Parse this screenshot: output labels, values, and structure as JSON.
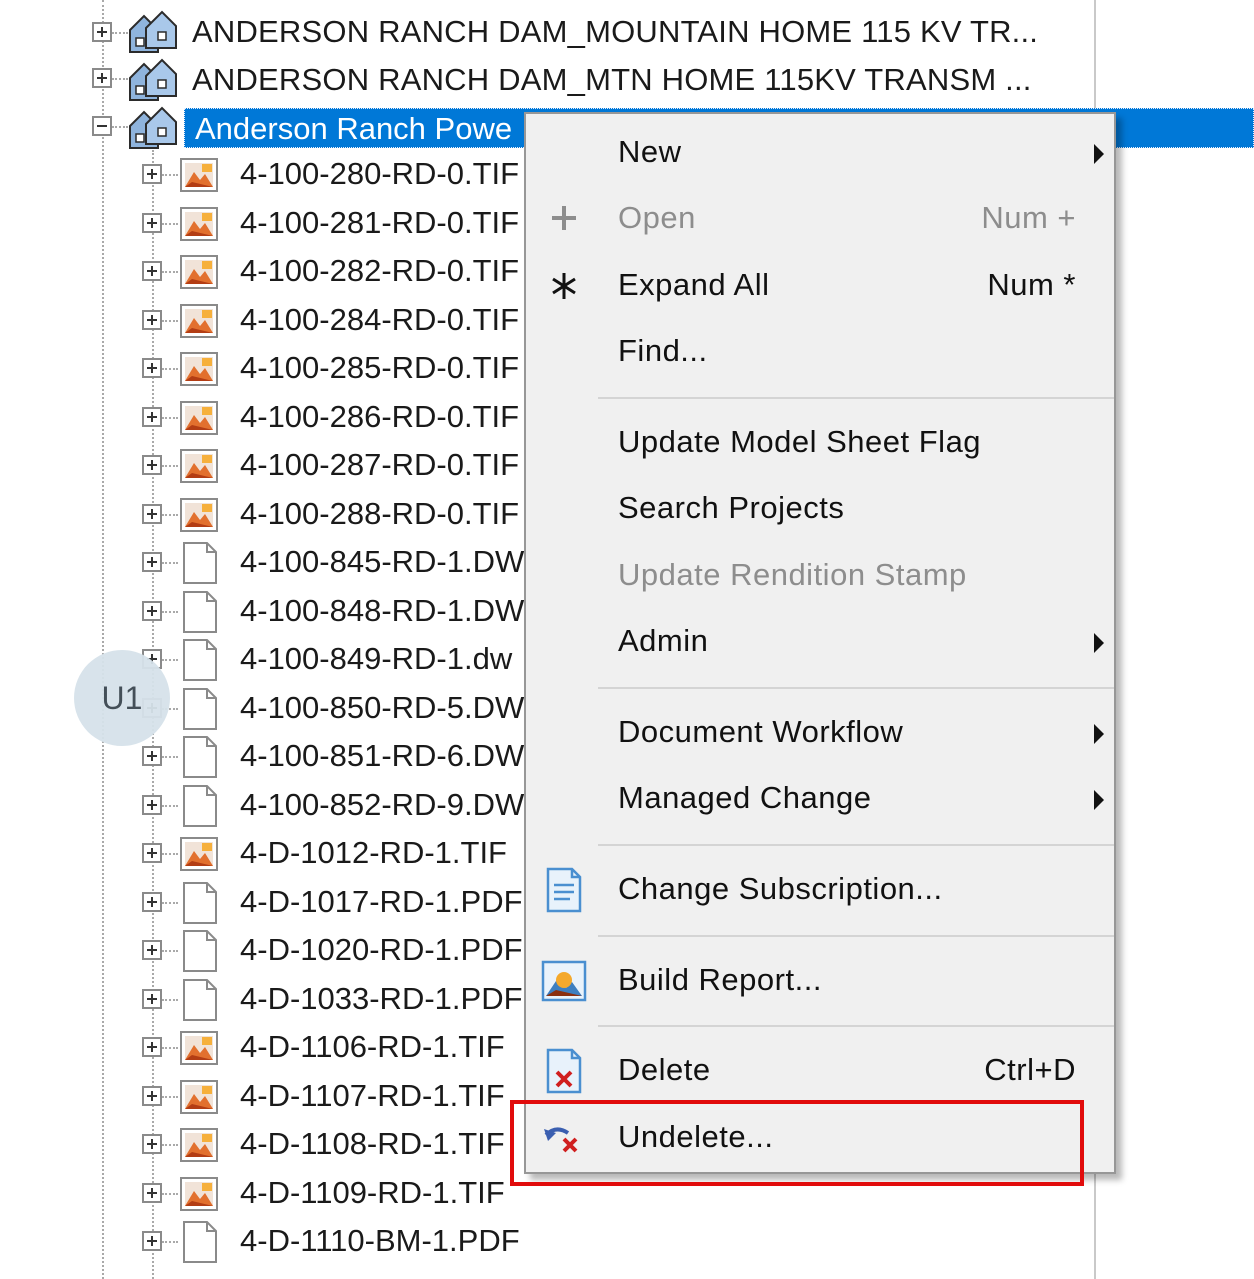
{
  "tree": {
    "top_rows": [
      {
        "label": "ANDERSON RANCH DAM_MOUNTAIN HOME 115 KV TR...",
        "expanded": false
      },
      {
        "label": "ANDERSON RANCH DAM_MTN HOME 115KV TRANSM ...",
        "expanded": false
      }
    ],
    "selected_row": {
      "label": "Anderson Ranch Powe",
      "expanded": true
    },
    "children": [
      {
        "label": "4-100-280-RD-0.TIF",
        "icon": "image-file-icon"
      },
      {
        "label": "4-100-281-RD-0.TIF",
        "icon": "image-file-icon"
      },
      {
        "label": "4-100-282-RD-0.TIF",
        "icon": "image-file-icon"
      },
      {
        "label": "4-100-284-RD-0.TIF",
        "icon": "image-file-icon"
      },
      {
        "label": "4-100-285-RD-0.TIF",
        "icon": "image-file-icon"
      },
      {
        "label": "4-100-286-RD-0.TIF",
        "icon": "image-file-icon"
      },
      {
        "label": "4-100-287-RD-0.TIF",
        "icon": "image-file-icon"
      },
      {
        "label": "4-100-288-RD-0.TIF",
        "icon": "image-file-icon"
      },
      {
        "label": "4-100-845-RD-1.DW",
        "icon": "document-file-icon"
      },
      {
        "label": "4-100-848-RD-1.DW",
        "icon": "document-file-icon"
      },
      {
        "label": "4-100-849-RD-1.dw",
        "icon": "document-file-icon"
      },
      {
        "label": "4-100-850-RD-5.DW",
        "icon": "document-file-icon"
      },
      {
        "label": "4-100-851-RD-6.DW",
        "icon": "document-file-icon"
      },
      {
        "label": "4-100-852-RD-9.DW",
        "icon": "document-file-icon"
      },
      {
        "label": "4-D-1012-RD-1.TIF",
        "icon": "image-file-icon"
      },
      {
        "label": "4-D-1017-RD-1.PDF",
        "icon": "document-file-icon"
      },
      {
        "label": "4-D-1020-RD-1.PDF",
        "icon": "document-file-icon"
      },
      {
        "label": "4-D-1033-RD-1.PDF",
        "icon": "document-file-icon"
      },
      {
        "label": "4-D-1106-RD-1.TIF",
        "icon": "image-file-icon"
      },
      {
        "label": "4-D-1107-RD-1.TIF",
        "icon": "image-file-icon"
      },
      {
        "label": "4-D-1108-RD-1.TIF",
        "icon": "image-file-icon"
      },
      {
        "label": "4-D-1109-RD-1.TIF",
        "icon": "image-file-icon"
      },
      {
        "label": "4-D-1110-BM-1.PDF",
        "icon": "document-file-icon"
      }
    ]
  },
  "badge": {
    "label": "U1"
  },
  "context_menu": {
    "items": [
      {
        "id": "new",
        "label": "New",
        "shortcut": "",
        "submenu": true,
        "disabled": false,
        "icon": ""
      },
      {
        "id": "open",
        "label": "Open",
        "shortcut": "Num +",
        "submenu": false,
        "disabled": true,
        "icon": "plus-icon"
      },
      {
        "id": "expand-all",
        "label": "Expand All",
        "shortcut": "Num *",
        "submenu": false,
        "disabled": false,
        "icon": "asterisk-icon"
      },
      {
        "id": "find",
        "label": "Find...",
        "shortcut": "",
        "submenu": false,
        "disabled": false,
        "icon": ""
      },
      {
        "id": "update-model-sheet-flag",
        "label": "Update Model Sheet Flag",
        "shortcut": "",
        "submenu": false,
        "disabled": false,
        "icon": ""
      },
      {
        "id": "search-projects",
        "label": "Search Projects",
        "shortcut": "",
        "submenu": false,
        "disabled": false,
        "icon": ""
      },
      {
        "id": "update-rendition-stamp",
        "label": "Update Rendition Stamp",
        "shortcut": "",
        "submenu": false,
        "disabled": true,
        "icon": ""
      },
      {
        "id": "admin",
        "label": "Admin",
        "shortcut": "",
        "submenu": true,
        "disabled": false,
        "icon": ""
      },
      {
        "id": "document-workflow",
        "label": "Document Workflow",
        "shortcut": "",
        "submenu": true,
        "disabled": false,
        "icon": ""
      },
      {
        "id": "managed-change",
        "label": "Managed Change",
        "shortcut": "",
        "submenu": true,
        "disabled": false,
        "icon": ""
      },
      {
        "id": "change-subscription",
        "label": "Change Subscription...",
        "shortcut": "",
        "submenu": false,
        "disabled": false,
        "icon": "subscription-document-icon"
      },
      {
        "id": "build-report",
        "label": "Build Report...",
        "shortcut": "",
        "submenu": false,
        "disabled": false,
        "icon": "report-image-icon"
      },
      {
        "id": "delete",
        "label": "Delete",
        "shortcut": "Ctrl+D",
        "submenu": false,
        "disabled": false,
        "icon": "delete-document-icon"
      },
      {
        "id": "undelete",
        "label": "Undelete...",
        "shortcut": "",
        "submenu": false,
        "disabled": false,
        "icon": "undelete-arrow-icon"
      }
    ]
  },
  "colors": {
    "selection": "#0078d7",
    "highlight_box": "#e10b0b",
    "menu_background": "#f0f0f0"
  }
}
